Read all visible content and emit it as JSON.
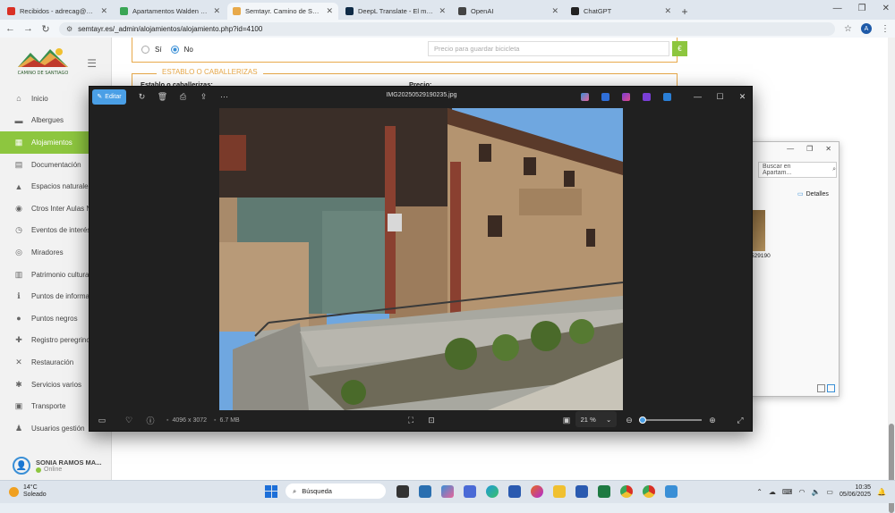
{
  "browser": {
    "tabs": [
      {
        "title": "Recibidos - adrecag@adrecag...",
        "color": "#d93025"
      },
      {
        "title": "Apartamentos Walden | gaiaro...",
        "color": "#3aa655"
      },
      {
        "title": "Semtayr. Camino de Santiago. E...",
        "color": "#e8a94a",
        "active": true
      },
      {
        "title": "DeepL Translate - El mejor trad...",
        "color": "#0f2b46"
      },
      {
        "title": "OpenAI",
        "color": "#444444"
      },
      {
        "title": "ChatGPT",
        "color": "#222222"
      }
    ],
    "url": "semtayr.es/_admin/alojamientos/alojamiento.php?id=4100",
    "profile_initial": "A"
  },
  "sidebar": {
    "logo_text": "CAMINO DE SANTIAGO",
    "items": [
      {
        "label": "Inicio",
        "icon": "⌂"
      },
      {
        "label": "Albergues",
        "icon": "▬"
      },
      {
        "label": "Alojamientos",
        "icon": "▦",
        "active": true
      },
      {
        "label": "Documentación",
        "icon": "▤"
      },
      {
        "label": "Espacios naturales",
        "icon": "▲"
      },
      {
        "label": "Ctros Inter Aulas N...",
        "icon": "◉"
      },
      {
        "label": "Eventos de interés",
        "icon": "◷"
      },
      {
        "label": "Miradores",
        "icon": "◎"
      },
      {
        "label": "Patrimonio cultural",
        "icon": "▥"
      },
      {
        "label": "Puntos de informac...",
        "icon": "ℹ"
      },
      {
        "label": "Puntos negros",
        "icon": "●"
      },
      {
        "label": "Registro peregrinos",
        "icon": "✚"
      },
      {
        "label": "Restauración",
        "icon": "✕"
      },
      {
        "label": "Servicios varios",
        "icon": "✱"
      },
      {
        "label": "Transporte",
        "icon": "▣"
      },
      {
        "label": "Usuarios gestión",
        "icon": "♟"
      }
    ],
    "user": {
      "name": "SONIA RAMOS MA...",
      "status": "Online"
    }
  },
  "form": {
    "radio_si": "Sí",
    "radio_no": "No",
    "price_bike_placeholder": "Precio para guardar bicicleta",
    "currency": "€",
    "stable_legend": "ESTABLO O CABALLERIZAS",
    "stable_label": "Establo o caballerizas:",
    "price_label": "Precio:"
  },
  "explorer": {
    "search_placeholder": "Buscar en Apartam...",
    "details_label": "Detalles",
    "file_name": "529190"
  },
  "photos": {
    "edit_label": "Editar",
    "file_title": "IMG20250529190235.jpg",
    "dimensions": "4096 x 3072",
    "size": "6.7 MB",
    "zoom": "21 %",
    "zoom_fraction": 0.0
  },
  "taskbar": {
    "temperature": "14°C",
    "weather": "Soleado",
    "search_label": "Búsqueda",
    "time": "10:35",
    "date": "05/06/2025"
  }
}
